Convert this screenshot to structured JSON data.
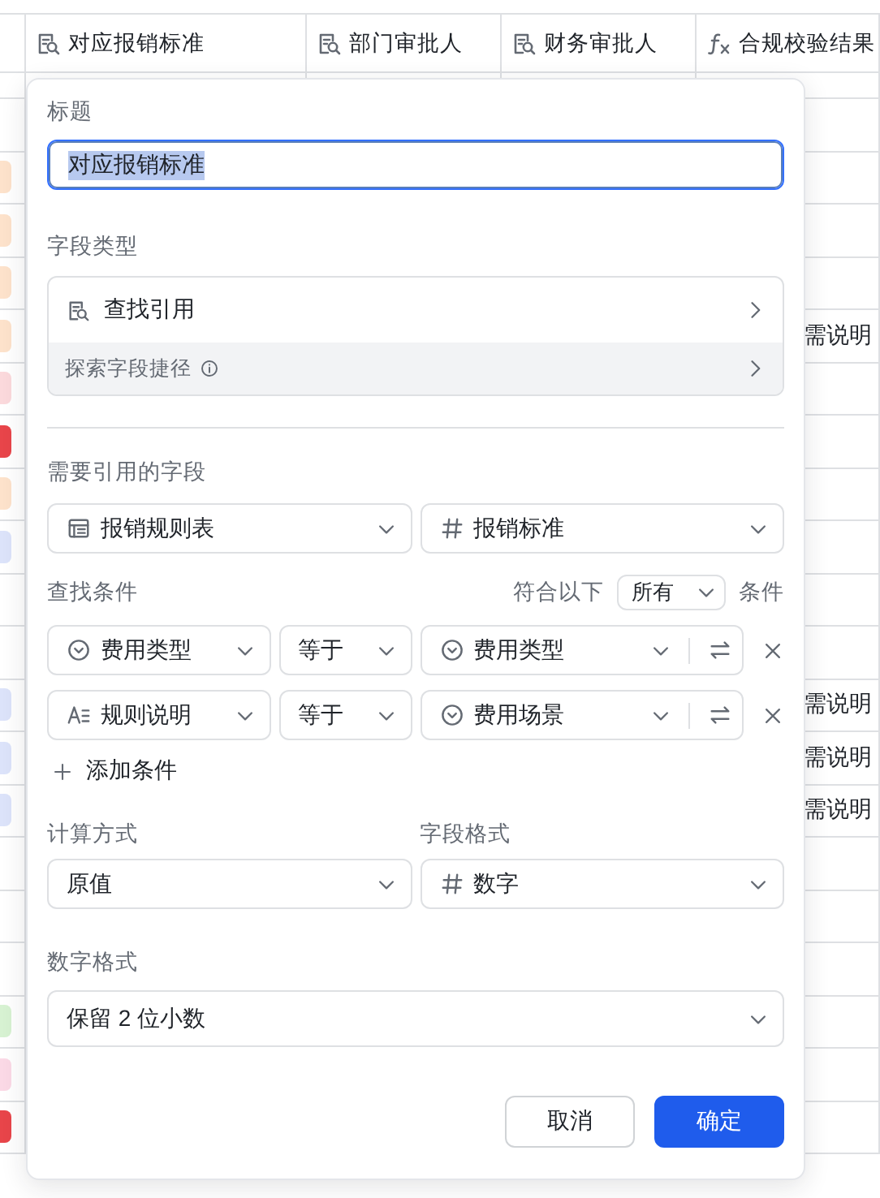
{
  "table": {
    "columns": [
      {
        "kind": "lookup",
        "label": "对应报销标准"
      },
      {
        "kind": "lookup",
        "label": "部门审批人"
      },
      {
        "kind": "lookup",
        "label": "财务审批人"
      },
      {
        "kind": "formula",
        "label": "合规校验结果"
      }
    ],
    "rows": [
      {},
      {
        "color": "#fde2cb"
      },
      {
        "color": "#fde2cb"
      },
      {
        "color": "#fde2cb"
      },
      {
        "color": "#fde2cb",
        "column_5": "需说明"
      },
      {
        "color": "#fbd9dc"
      },
      {
        "color": "#e8454a"
      },
      {
        "color": "#fde2cb"
      },
      {
        "color": "#dce3fa"
      },
      {},
      {},
      {
        "color": "#dce3fa",
        "column_5": "需说明"
      },
      {
        "color": "#dce3fa",
        "column_5": "需说明"
      },
      {
        "color": "#dce3fa",
        "column_5": "需说明"
      },
      {},
      {},
      {},
      {
        "color": "#d7f2d2"
      },
      {
        "color": "#fbd9e6"
      },
      {
        "color": "#e8454a"
      }
    ]
  },
  "dialog": {
    "title_label": "标题",
    "title_input": {
      "value": "对应报销标准",
      "selected": true
    },
    "field_type_label": "字段类型",
    "field_type": {
      "kind": "lookup",
      "label": "查找引用"
    },
    "shortcut": {
      "label": "探索字段捷径"
    },
    "reference_label": "需要引用的字段",
    "reference": {
      "table": {
        "kind": "table",
        "value": "报销规则表"
      },
      "field": {
        "kind": "number",
        "value": "报销标准"
      }
    },
    "conditions_label": "查找条件",
    "match": {
      "prefix": "符合以下",
      "value": "所有",
      "suffix": "条件"
    },
    "conditions": [
      {
        "field": {
          "kind": "option",
          "value": "费用类型"
        },
        "operator": "等于",
        "value": {
          "kind": "option",
          "value": "费用类型"
        }
      },
      {
        "field": {
          "kind": "text",
          "value": "规则说明"
        },
        "operator": "等于",
        "value": {
          "kind": "option",
          "value": "费用场景"
        }
      }
    ],
    "add_condition": "添加条件",
    "calc_label": "计算方式",
    "calc": "原值",
    "format_label": "字段格式",
    "format": {
      "kind": "number",
      "value": "数字"
    },
    "number_format_label": "数字格式",
    "number_format": "保留 2 位小数",
    "buttons": [
      {
        "label": "取消",
        "kind": "secondary"
      },
      {
        "label": "确定",
        "kind": "primary"
      }
    ]
  }
}
